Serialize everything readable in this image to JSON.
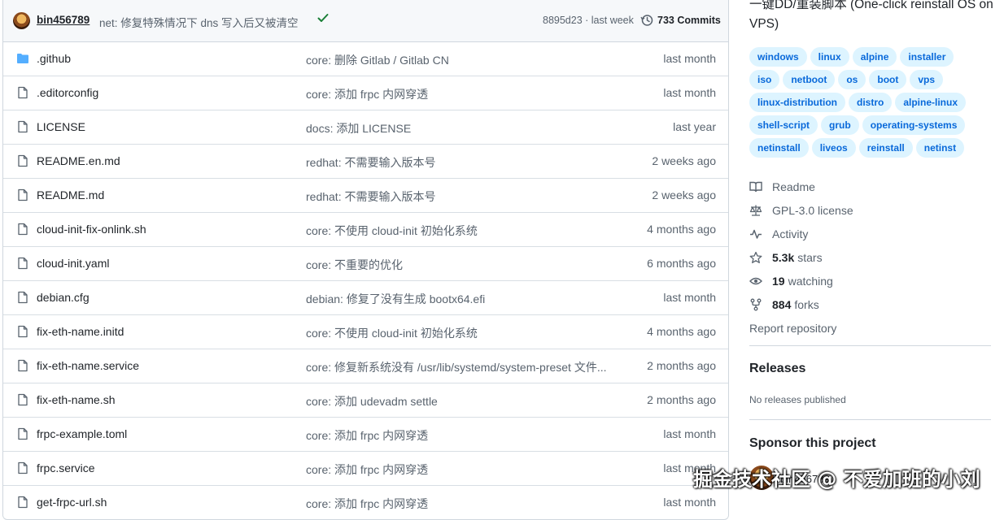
{
  "latest_commit": {
    "author": "bin456789",
    "message": "net: 修复特殊情况下 dns 写入后又被清空",
    "hash_time": "8895d23 · last week",
    "commits_count": "733 Commits"
  },
  "files": [
    {
      "type": "folder",
      "name": ".github",
      "message": "core: 删除 Gitlab / Gitlab CN",
      "date": "last month"
    },
    {
      "type": "file",
      "name": ".editorconfig",
      "message": "core: 添加 frpc 内网穿透",
      "date": "last month"
    },
    {
      "type": "file",
      "name": "LICENSE",
      "message": "docs: 添加 LICENSE",
      "date": "last year"
    },
    {
      "type": "file",
      "name": "README.en.md",
      "message": "redhat: 不需要输入版本号",
      "date": "2 weeks ago"
    },
    {
      "type": "file",
      "name": "README.md",
      "message": "redhat: 不需要输入版本号",
      "date": "2 weeks ago"
    },
    {
      "type": "file",
      "name": "cloud-init-fix-onlink.sh",
      "message": "core: 不使用 cloud-init 初始化系统",
      "date": "4 months ago"
    },
    {
      "type": "file",
      "name": "cloud-init.yaml",
      "message": "core: 不重要的优化",
      "date": "6 months ago"
    },
    {
      "type": "file",
      "name": "debian.cfg",
      "message": "debian: 修复了没有生成 bootx64.efi",
      "date": "last month"
    },
    {
      "type": "file",
      "name": "fix-eth-name.initd",
      "message": "core: 不使用 cloud-init 初始化系统",
      "date": "4 months ago"
    },
    {
      "type": "file",
      "name": "fix-eth-name.service",
      "message": "core: 修复新系统没有 /usr/lib/systemd/system-preset 文件...",
      "date": "2 months ago"
    },
    {
      "type": "file",
      "name": "fix-eth-name.sh",
      "message": "core: 添加 udevadm settle",
      "date": "2 months ago"
    },
    {
      "type": "file",
      "name": "frpc-example.toml",
      "message": "core: 添加 frpc 内网穿透",
      "date": "last month"
    },
    {
      "type": "file",
      "name": "frpc.service",
      "message": "core: 添加 frpc 内网穿透",
      "date": "last month"
    },
    {
      "type": "file",
      "name": "get-frpc-url.sh",
      "message": "core: 添加 frpc 内网穿透",
      "date": "last month"
    }
  ],
  "about": {
    "description": "一键DD/重装脚本 (One-click reinstall OS on VPS)",
    "topics": [
      "windows",
      "linux",
      "alpine",
      "installer",
      "iso",
      "netboot",
      "os",
      "boot",
      "vps",
      "linux-distribution",
      "distro",
      "alpine-linux",
      "shell-script",
      "grub",
      "operating-systems",
      "netinstall",
      "liveos",
      "reinstall",
      "netinst"
    ],
    "readme": "Readme",
    "license": "GPL-3.0 license",
    "activity": "Activity",
    "stars_count": "5.3k",
    "stars_label": "stars",
    "watching_count": "19",
    "watching_label": "watching",
    "forks_count": "884",
    "forks_label": "forks",
    "report": "Report repository"
  },
  "releases": {
    "title": "Releases",
    "empty": "No releases published"
  },
  "sponsor": {
    "title": "Sponsor this project",
    "name": "bin456789"
  },
  "watermark": "掘金技术社区 @ 不爱加班的小刘",
  "colors": {
    "link": "#0969da",
    "topic_bg": "#ddf4ff",
    "success": "#1a7f37",
    "folder": "#54aeff"
  }
}
